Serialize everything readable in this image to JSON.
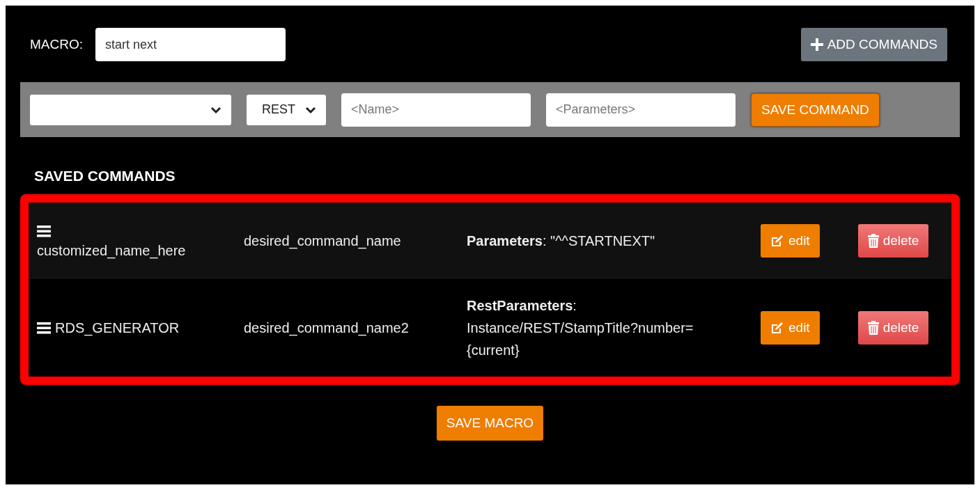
{
  "macro": {
    "label": "MACRO:",
    "value": "start next"
  },
  "add_button": {
    "label": "ADD COMMANDS"
  },
  "command_form": {
    "type_select": {
      "value": "REST"
    },
    "name_field": {
      "placeholder": "<Name>"
    },
    "parameters_field": {
      "placeholder": "<Parameters>"
    },
    "save_button": "SAVE COMMAND"
  },
  "saved_commands": {
    "heading": "SAVED COMMANDS",
    "highlighted": true,
    "rows": [
      {
        "name": "customized_name_here",
        "command": "desired_command_name",
        "parameters": "**Parameters**: \"^^STARTNEXT\"",
        "edit": "edit",
        "delete": "delete"
      },
      {
        "name": "RDS_GENERATOR",
        "command": "desired_command_name2",
        "parameters": "**RestParameters**: Instance/REST/StampTitle?number={current}",
        "edit": "edit",
        "delete": "delete"
      }
    ]
  },
  "save_macro": "SAVE MACRO"
}
